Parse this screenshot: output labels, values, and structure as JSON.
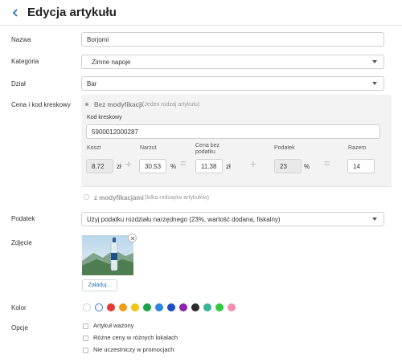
{
  "header": {
    "title": "Edycja artykułu"
  },
  "form": {
    "name": {
      "label": "Nazwa",
      "value": "Borjomi"
    },
    "category": {
      "label": "Kategoria",
      "value": "Zimne napoje"
    },
    "department": {
      "label": "Dział",
      "value": "Bar"
    },
    "price_barcode": {
      "label": "Cena i kod kreskowy",
      "no_mod_label": "Bez modyfikacji",
      "no_mod_hint": "(Jeden rodzaj artykułu)",
      "barcode_label": "Kod kreskowy",
      "barcode_value": "5900012000287",
      "cost_label": "Koszt",
      "cost_value": "8.72",
      "currency_unit": "zł",
      "markup_label": "Narzut",
      "markup_value": "30.53",
      "percent_unit": "%",
      "net_price_label_1": "Cena bez",
      "net_price_label_2": "podatku",
      "net_price_value": "11.38",
      "tax_label": "Podatek",
      "tax_value": "23",
      "total_label": "Razem",
      "total_value": "14",
      "plus1": "+",
      "equals1": "=",
      "plus2": "+",
      "equals2": "=",
      "with_mod_label": "z modyfikacjami",
      "with_mod_hint": "(kilka rodzajów artykułów)"
    },
    "tax": {
      "label": "Podatek",
      "value": "Użyj podatku rozdziału narzędnego (23%, wartość dodana, fiskalny)"
    },
    "photo": {
      "label": "Zdjęcie",
      "upload_label": "Załaduj..."
    },
    "color": {
      "label": "Kolor",
      "swatches": [
        "#ffffff",
        "#ffffff",
        "#e53935",
        "#f39c12",
        "#f1c40f",
        "#1aa34a",
        "#2e86de",
        "#1e4fc2",
        "#8e24aa",
        "#2b2b2b",
        "#3bb39a",
        "#2ecc40",
        "#f48fb1"
      ]
    },
    "options": {
      "label": "Opcje",
      "items": [
        "Artykuł ważony",
        "Różne ceny w różnych lokalach",
        "Nie uczestniczy w promocjach"
      ]
    }
  }
}
